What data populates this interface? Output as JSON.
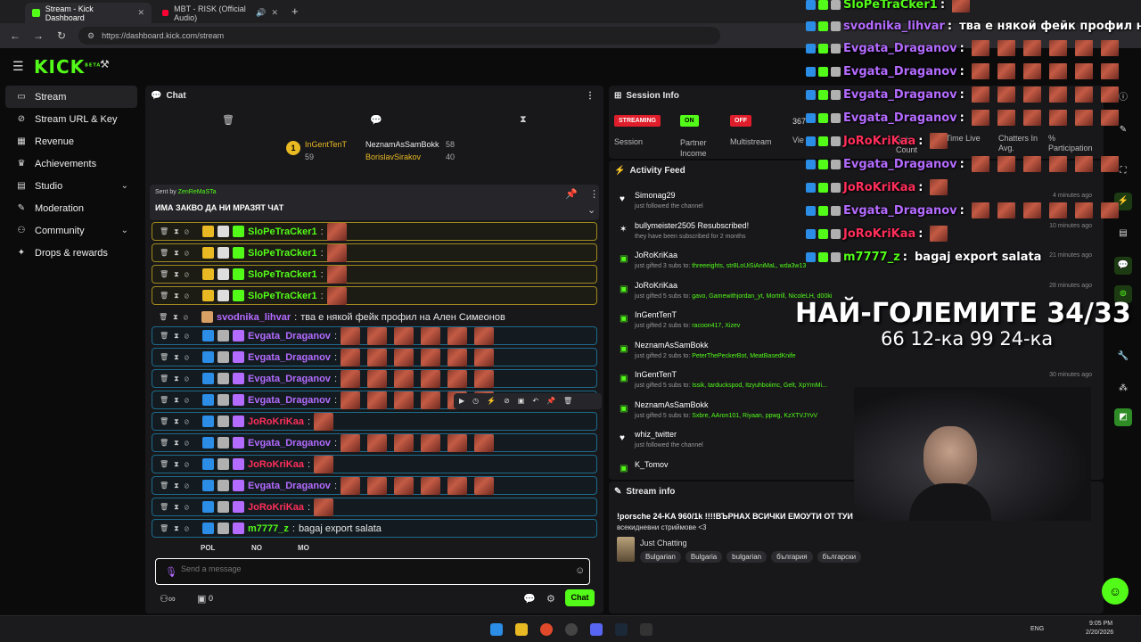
{
  "browser": {
    "tabs": [
      {
        "label": "Stream - Kick Dashboard",
        "close": "✕"
      },
      {
        "label": "MBT - RISK (Official Audio)",
        "close": "✕"
      }
    ],
    "new_tab": "+",
    "url": "https://dashboard.kick.com/stream"
  },
  "brand": {
    "logo": "KICK",
    "beta": "BETA"
  },
  "sidebar": {
    "items": [
      {
        "label": "Stream",
        "icon": "stream-icon"
      },
      {
        "label": "Stream URL & Key",
        "icon": "key-icon"
      },
      {
        "label": "Revenue",
        "icon": "revenue-icon"
      },
      {
        "label": "Achievements",
        "icon": "trophy-icon"
      },
      {
        "label": "Studio",
        "icon": "studio-icon"
      },
      {
        "label": "Moderation",
        "icon": "moderation-icon"
      },
      {
        "label": "Community",
        "icon": "community-icon"
      },
      {
        "label": "Drops & rewards",
        "icon": "gift-icon"
      }
    ]
  },
  "chat": {
    "title": "Chat",
    "leaderboard": [
      {
        "name": "InGentTenT",
        "count": "59"
      },
      {
        "name": "NeznamAsSamBokk",
        "count": "58"
      },
      {
        "name": "BorislavSirakov",
        "count": "40"
      }
    ],
    "pinned": {
      "sent_by": "Sent by",
      "user": "ZenReMaSTa",
      "text": "ИМА ЗАКВО ДА НИ МРАЗЯТ ЧАТ"
    },
    "messages": [
      {
        "user": "SloPeTraCker1",
        "color": "#53fc18",
        "style": "gold",
        "emotes": 1,
        "text": ""
      },
      {
        "user": "SloPeTraCker1",
        "color": "#53fc18",
        "style": "gold",
        "emotes": 1,
        "text": ""
      },
      {
        "user": "SloPeTraCker1",
        "color": "#53fc18",
        "style": "gold",
        "emotes": 1,
        "text": ""
      },
      {
        "user": "SloPeTraCker1",
        "color": "#53fc18",
        "style": "gold",
        "emotes": 1,
        "text": ""
      },
      {
        "user": "svodnika_lihvar",
        "color": "#b46bff",
        "style": "none",
        "emotes": 0,
        "text": "тва е някой фейк профил на Ален Симеонов"
      },
      {
        "user": "Evgata_Draganov",
        "color": "#b46bff",
        "style": "blue",
        "emotes": 6,
        "text": ""
      },
      {
        "user": "Evgata_Draganov",
        "color": "#b46bff",
        "style": "blue",
        "emotes": 6,
        "text": ""
      },
      {
        "user": "Evgata_Draganov",
        "color": "#b46bff",
        "style": "blue",
        "emotes": 6,
        "text": ""
      },
      {
        "user": "Evgata_Draganov",
        "color": "#b46bff",
        "style": "blue",
        "emotes": 6,
        "text": ""
      },
      {
        "user": "JoRoKriKaa",
        "color": "#ff2e5a",
        "style": "blue",
        "emotes": 1,
        "text": ""
      },
      {
        "user": "Evgata_Draganov",
        "color": "#b46bff",
        "style": "blue",
        "emotes": 6,
        "text": ""
      },
      {
        "user": "JoRoKriKaa",
        "color": "#ff2e5a",
        "style": "blue",
        "emotes": 1,
        "text": ""
      },
      {
        "user": "Evgata_Draganov",
        "color": "#b46bff",
        "style": "blue",
        "emotes": 6,
        "text": ""
      },
      {
        "user": "JoRoKriKaa",
        "color": "#ff2e5a",
        "style": "blue",
        "emotes": 1,
        "text": ""
      },
      {
        "user": "m7777_z",
        "color": "#53fc18",
        "style": "blue",
        "emotes": 0,
        "text": "bagaj export salata"
      }
    ],
    "emote_bar": [
      "POL",
      "NO",
      "MO"
    ],
    "input_placeholder": "Send a message",
    "footer_count": "0",
    "chat_button": "Chat"
  },
  "session": {
    "title": "Session Info",
    "stats": [
      {
        "badge": "STREAMING",
        "label": "Session",
        "color": "#e01e2b"
      },
      {
        "badge": "ON",
        "label": "Partner Income",
        "color": "#53fc18"
      },
      {
        "badge": "OFF",
        "label": "Multistream",
        "color": "#e01e2b"
      }
    ],
    "viewers_value": "367",
    "viewers_label": "Vie",
    "extra_labels": [
      "Sub Count",
      "Time Live",
      "Chatters In Avg.",
      "% Participation"
    ]
  },
  "activity": {
    "title": "Activity Feed",
    "items": [
      {
        "user": "Simonag29",
        "text": "just followed the channel",
        "time": "4 minutes ago",
        "icon": "heart-icon",
        "names": ""
      },
      {
        "user": "bullymeister2505 Resubscribed!",
        "text": "they have been subscribed for 2 months",
        "time": "10 minutes ago",
        "icon": "star-icon",
        "names": ""
      },
      {
        "user": "JoRoKriKaa",
        "text": "just gifted 3 subs to:",
        "time": "21 minutes ago",
        "icon": "gift-icon",
        "names": "threeeights, str8LoUiSiAniMaL, wda3w13"
      },
      {
        "user": "JoRoKriKaa",
        "text": "just gifted 5 subs to:",
        "time": "28 minutes ago",
        "icon": "gift-icon",
        "names": "gavo, Gamewithjordan_yt, Mortrill, NicoleLH, d00ki"
      },
      {
        "user": "InGentTenT",
        "text": "just gifted 2 subs to:",
        "time": "",
        "icon": "gift-icon",
        "names": "racoon417, Xizev"
      },
      {
        "user": "NeznamAsSamBokk",
        "text": "just gifted 2 subs to:",
        "time": "",
        "icon": "gift-icon",
        "names": "PeterThePeckerBot, MeatBasedKnife"
      },
      {
        "user": "InGentTenT",
        "text": "just gifted 5 subs to:",
        "time": "30 minutes ago",
        "icon": "gift-icon",
        "names": "Issik, tarduckspod, Itzyuhboiimc, Gelt, XpYmMi..."
      },
      {
        "user": "NeznamAsSamBokk",
        "text": "just gifted 5 subs to:",
        "time": "",
        "icon": "gift-icon",
        "names": "Sxbre, AAron101, Riyaan, ppwg, KzXTVJYvV"
      },
      {
        "user": "whiz_twitter",
        "text": "just followed the channel",
        "time": "",
        "icon": "heart-icon",
        "names": ""
      },
      {
        "user": "K_Tomov",
        "text": "",
        "time": "",
        "icon": "gift-icon",
        "names": ""
      }
    ]
  },
  "stream_info": {
    "title": "Stream info",
    "stream_title": "!porsche 24-KA 960/1k !!!!ВЪРНАХ ВСИЧКИ ЕМОУТИ ОТ ТУИ",
    "stream_title_2": "всекидневни стриймове <3",
    "category": "Just Chatting",
    "tags": [
      "Bulgarian",
      "Bulgaria",
      "bulgarian",
      "българия",
      "български"
    ]
  },
  "overlay": {
    "lines": [
      {
        "user": "SloPeTraCker1",
        "text": "",
        "color": "#53fc18",
        "emotes": 1
      },
      {
        "user": "svodnika_lihvar",
        "text": "тва е някой фейк профил на Ален Си",
        "color": "#b46bff",
        "emotes": 0
      },
      {
        "user": "Evgata_Draganov",
        "text": "",
        "color": "#b46bff",
        "emotes": 6
      },
      {
        "user": "Evgata_Draganov",
        "text": "",
        "color": "#b46bff",
        "emotes": 6
      },
      {
        "user": "Evgata_Draganov",
        "text": "",
        "color": "#b46bff",
        "emotes": 6
      },
      {
        "user": "Evgata_Draganov",
        "text": "",
        "color": "#b46bff",
        "emotes": 6
      },
      {
        "user": "JoRoKriKaa",
        "text": "",
        "color": "#ff2e5a",
        "emotes": 1
      },
      {
        "user": "Evgata_Draganov",
        "text": "",
        "color": "#b46bff",
        "emotes": 6
      },
      {
        "user": "JoRoKriKaa",
        "text": "",
        "color": "#ff2e5a",
        "emotes": 1
      },
      {
        "user": "Evgata_Draganov",
        "text": "",
        "color": "#b46bff",
        "emotes": 6
      },
      {
        "user": "JoRoKriKaa",
        "text": "",
        "color": "#ff2e5a",
        "emotes": 1
      },
      {
        "user": "m7777_z",
        "text": "bagaj export salata",
        "color": "#53fc18",
        "emotes": 0
      }
    ],
    "goal_title": "НАЙ-ГОЛЕМИТЕ 34/33",
    "goal_sub": "66 12-ка 99 24-ка"
  },
  "taskbar": {
    "lang": "ENG",
    "time": "9:05 PM",
    "date": "2/20/2026"
  },
  "colors": {
    "accent": "#53fc18",
    "panel": "#18181b",
    "bg": "#0b0b0c"
  }
}
